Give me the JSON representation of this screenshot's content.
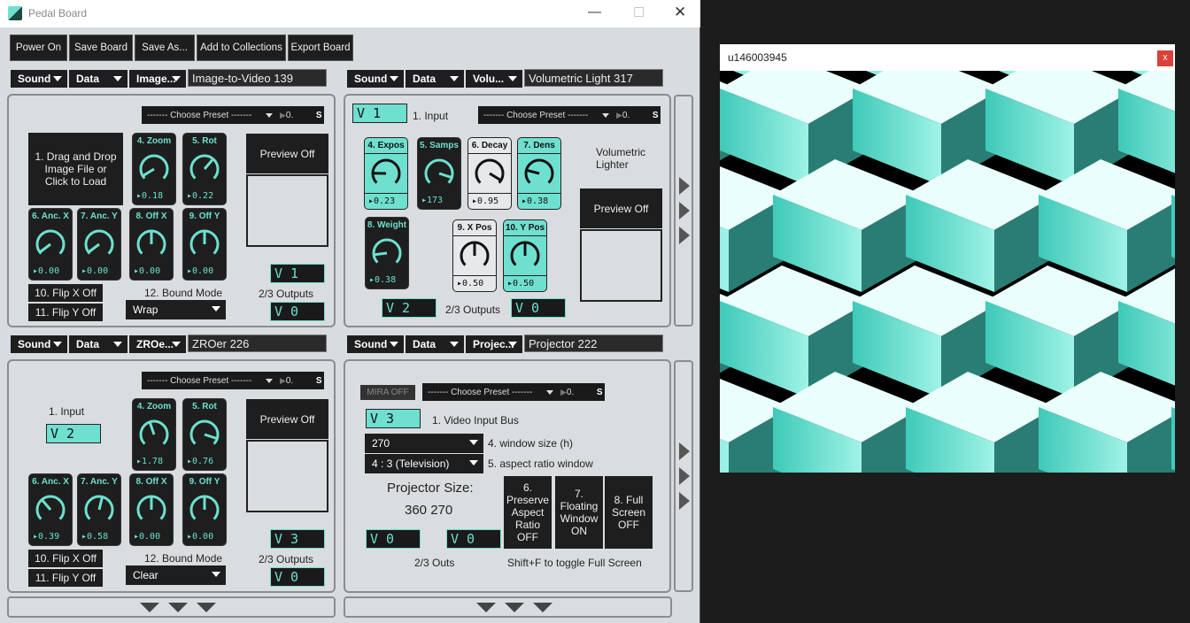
{
  "window": {
    "title": "Pedal Board"
  },
  "toolbar": [
    "Power On",
    "Save Board",
    "Save As...",
    "Add to Collections",
    "Export Board"
  ],
  "preset": {
    "label": "------- Choose Preset -------",
    "num": "0.",
    "s": "S"
  },
  "colors": {
    "teal": "#6fe0d0",
    "dark": "#1e1e1e"
  },
  "modules": [
    {
      "dd": [
        "Sound",
        "Data",
        "Image..."
      ],
      "name": "Image-to-Video 139",
      "load": "1. Drag and Drop Image File or Click to Load",
      "preview": "Preview Off",
      "knobs": [
        {
          "label": "4. Zoom",
          "value": "0.18",
          "pos": 0.05
        },
        {
          "label": "5. Rot",
          "value": "0.22",
          "pos": 0.65
        },
        {
          "label": "6. Anc. X",
          "value": "0.00",
          "pos": 0.03
        },
        {
          "label": "7. Anc. Y",
          "value": "0.00",
          "pos": 0.03
        },
        {
          "label": "8. Off X",
          "value": "0.00",
          "pos": 0.5
        },
        {
          "label": "9. Off Y",
          "value": "0.00",
          "pos": 0.5
        }
      ],
      "flipx": "10. Flip X Off",
      "flipy": "11. Flip Y Off",
      "bound_label": "12. Bound Mode",
      "bound": "Wrap",
      "out1": "V 1",
      "out_label": "2/3  Outputs",
      "out2": "V 0"
    },
    {
      "dd": [
        "Sound",
        "Data",
        "Volu..."
      ],
      "name": "Volumetric Light 317",
      "input": "V 1",
      "input_label": "1.  Input",
      "desc": "Volumetric Lighter",
      "preview": "Preview Off",
      "knobs": [
        {
          "label": "4. Expos",
          "value": "0.23",
          "pos": 0.17
        },
        {
          "label": "5. Samps",
          "value": "173",
          "pos": 0.9
        },
        {
          "label": "6. Decay",
          "value": "0.95",
          "pos": 0.95
        },
        {
          "label": "7. Dens",
          "value": "0.38",
          "pos": 0.22
        },
        {
          "label": "8. Weight",
          "value": "0.38",
          "pos": 0.14
        },
        {
          "label": "9. X Pos",
          "value": "0.50",
          "pos": 0.5
        },
        {
          "label": "10. Y Pos",
          "value": "0.50",
          "pos": 0.5
        }
      ],
      "out1": "V 2",
      "out_label": "2/3  Outputs",
      "out2": "V 0"
    },
    {
      "dd": [
        "Sound",
        "Data",
        "ZROe..."
      ],
      "name": "ZROer 226",
      "input_label": "1.  Input",
      "input": "V 2",
      "preview": "Preview Off",
      "knobs": [
        {
          "label": "4. Zoom",
          "value": "1.78",
          "pos": 0.43
        },
        {
          "label": "5. Rot",
          "value": "0.76",
          "pos": 0.9
        },
        {
          "label": "6. Anc. X",
          "value": "0.39",
          "pos": 0.35
        },
        {
          "label": "7. Anc. Y",
          "value": "0.58",
          "pos": 0.55
        },
        {
          "label": "8. Off X",
          "value": "0.00",
          "pos": 0.5
        },
        {
          "label": "9. Off Y",
          "value": "0.00",
          "pos": 0.5
        }
      ],
      "flipx": "10. Flip X Off",
      "flipy": "11. Flip Y Off",
      "bound_label": "12. Bound Mode",
      "bound": "Clear",
      "out1": "V 3",
      "out_label": "2/3  Outputs",
      "out2": "V 0"
    },
    {
      "dd": [
        "Sound",
        "Data",
        "Projec..."
      ],
      "name": "Projector 222",
      "mira": "MIRA OFF",
      "input": "V 3",
      "input_label": "1. Video Input Bus",
      "size": "270",
      "size_label": "4. window size (h)",
      "aspect": "4 : 3 (Television)",
      "aspect_label": "5. aspect ratio window",
      "proj_label": "Projector Size:",
      "proj_value": "360 270",
      "b6": "6. Preserve Aspect Ratio OFF",
      "b7": "7. Floating Window ON",
      "b8": "8. Full Screen OFF",
      "out1": "V 0",
      "out2": "V 0",
      "outs_label": "2/3 Outs",
      "hint": "Shift+F to toggle Full Screen"
    }
  ],
  "video": {
    "title": "u146003945",
    "close": "x"
  }
}
